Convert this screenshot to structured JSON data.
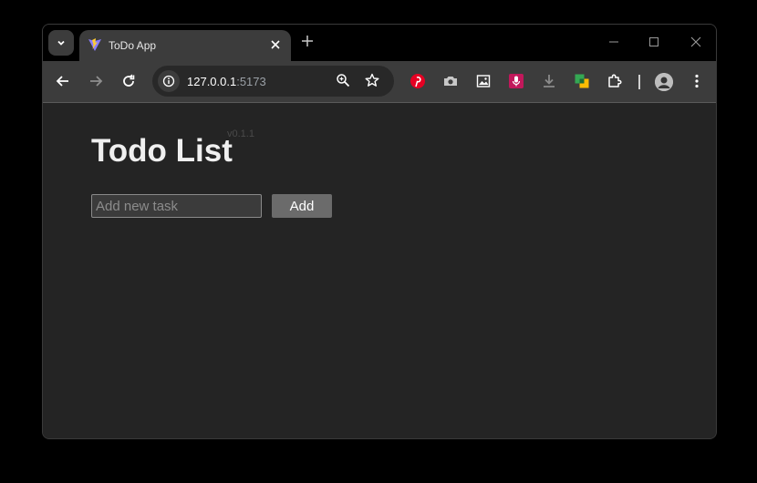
{
  "browser": {
    "tab": {
      "title": "ToDo App"
    },
    "address": {
      "host": "127.0.0.1",
      "port": ":5173"
    }
  },
  "page": {
    "heading": "Todo List",
    "version": "v0.1.1",
    "input": {
      "placeholder": "Add new task",
      "value": ""
    },
    "add_label": "Add"
  },
  "colors": {
    "page_bg": "#242424",
    "toolbar_bg": "#3c3c3c",
    "button_bg": "#6b6b6b"
  }
}
